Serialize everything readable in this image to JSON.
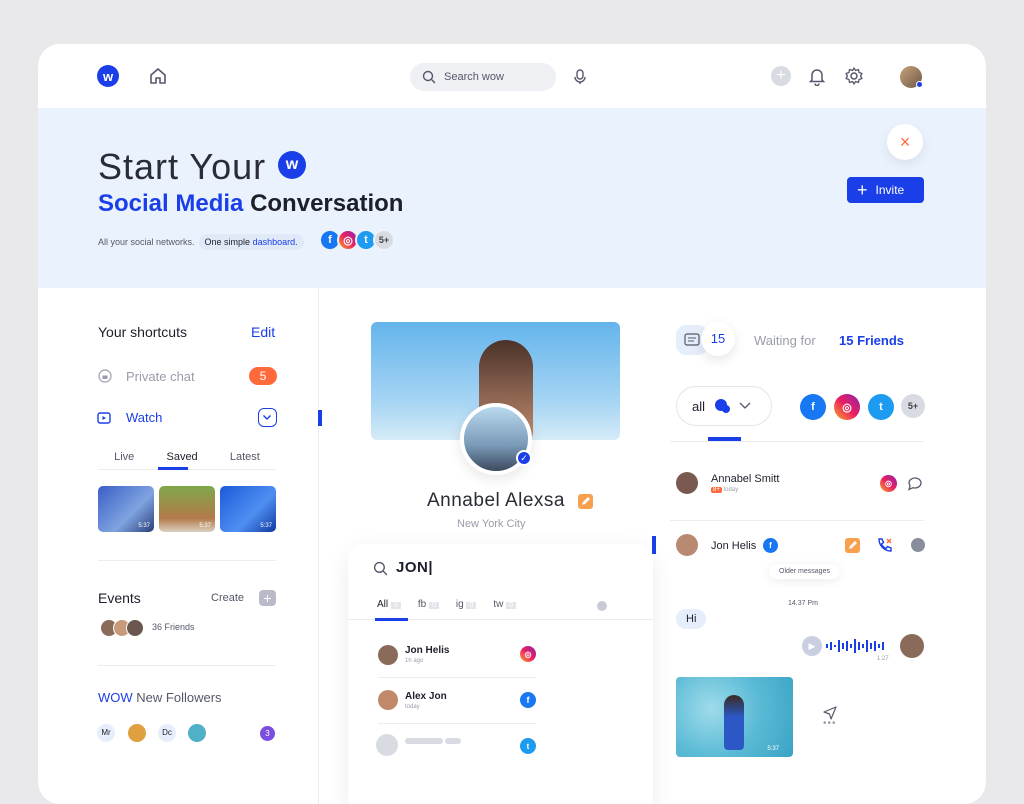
{
  "search": {
    "placeholder": "Search wow"
  },
  "hero": {
    "title_light": "Start Your",
    "title_blue": "Social Media",
    "title_dark": "Conversation",
    "sub_text": "All your social networks.",
    "pill_text": "One simple",
    "pill_link": "dashboard.",
    "more_count": "5+",
    "invite_label": "Invite",
    "close_label": "×"
  },
  "shortcuts": {
    "title": "Your shortcuts",
    "edit": "Edit",
    "private_chat": "Private chat",
    "private_count": "5",
    "watch": "Watch",
    "tabs": [
      "Live",
      "Saved",
      "Latest"
    ],
    "active_tab": "Saved",
    "thumb_durations": [
      "5:37",
      "5:37",
      "5:37"
    ]
  },
  "events": {
    "title": "Events",
    "create": "Create",
    "friends": "36 Friends"
  },
  "followers": {
    "wow": "WOW",
    "rest": "New Followers",
    "avatars": [
      "Mr",
      "Dc"
    ],
    "count": "3"
  },
  "profile": {
    "name": "Annabel Alexsa",
    "city": "New York City"
  },
  "search_panel": {
    "query": "JON",
    "tabs": [
      {
        "label": "All",
        "count": "0"
      },
      {
        "label": "fb",
        "count": "0"
      },
      {
        "label": "ig",
        "count": "0"
      },
      {
        "label": "tw",
        "count": "0"
      }
    ],
    "results": [
      {
        "name": "Jon Helis",
        "time": "1h ago"
      },
      {
        "name": "Alex Jon",
        "time": "today"
      }
    ]
  },
  "waiting": {
    "count": "15",
    "label": "Waiting for",
    "friends": "15 Friends"
  },
  "filter": {
    "all": "all",
    "more": "5+"
  },
  "chats": [
    {
      "name": "Annabel Smitt",
      "badge": "8+",
      "time": "today"
    },
    {
      "name": "Jon Helis"
    }
  ],
  "conversation": {
    "older": "Older messages",
    "time": "14.37 Pm",
    "hi": "Hi",
    "audio_time": "1:27",
    "video_time": "5:37"
  },
  "colors": {
    "accent": "#1a3ee8",
    "orange": "#ff6a3d",
    "hero_bg": "#eaf3fd"
  }
}
